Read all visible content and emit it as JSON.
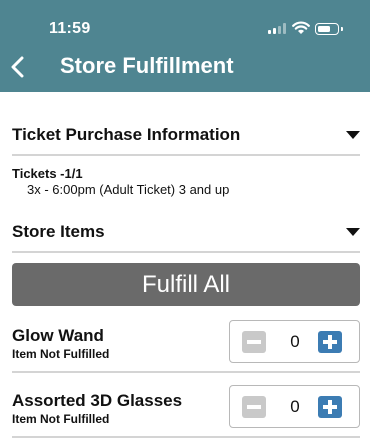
{
  "status_bar": {
    "time": "11:59"
  },
  "header": {
    "title": "Store Fulfillment",
    "back_icon": "chevron-left-icon"
  },
  "sections": {
    "ticket_purchase": {
      "label": "Ticket Purchase Information"
    },
    "store_items": {
      "label": "Store Items"
    }
  },
  "tickets": {
    "title": "Tickets -1/1",
    "line": "3x - 6:00pm (Adult Ticket) 3 and up"
  },
  "fulfill_all_label": "Fulfill All",
  "items": [
    {
      "name": "Glow Wand",
      "status": "Item Not Fulfilled",
      "quantity": "0"
    },
    {
      "name": "Assorted 3D Glasses",
      "status": "Item Not Fulfilled",
      "quantity": "0"
    }
  ],
  "colors": {
    "header_bg": "#4f8591",
    "fulfill_button": "#6a6a6a",
    "plus_button": "#3c7cb3",
    "minus_button": "#c9c9c9"
  }
}
